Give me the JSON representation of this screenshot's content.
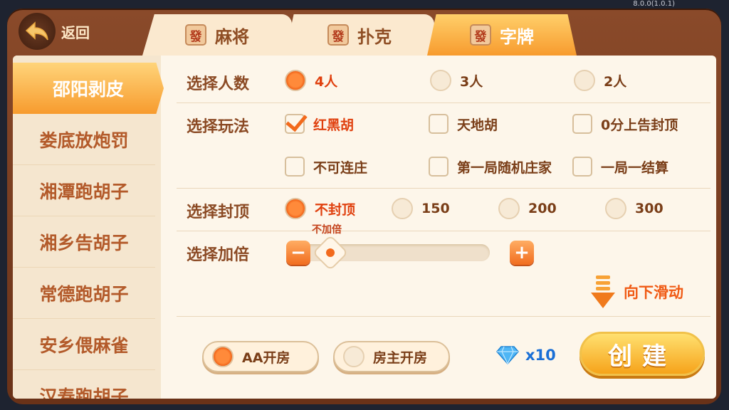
{
  "version": "8.0.0(1.0.1)",
  "header": {
    "back_label": "返回",
    "tabs": [
      {
        "tile": "發",
        "label": "麻将"
      },
      {
        "tile": "發",
        "label": "扑克"
      },
      {
        "tile": "發",
        "label": "字牌",
        "active": true
      }
    ]
  },
  "sidebar": {
    "items": [
      {
        "label": "邵阳剥皮",
        "active": true
      },
      {
        "label": "娄底放炮罚"
      },
      {
        "label": "湘潭跑胡子"
      },
      {
        "label": "湘乡告胡子"
      },
      {
        "label": "常德跑胡子"
      },
      {
        "label": "安乡偎麻雀"
      },
      {
        "label": "汉寿跑胡子"
      }
    ]
  },
  "form": {
    "players": {
      "label": "选择人数",
      "options": [
        {
          "label": "4人",
          "selected": true
        },
        {
          "label": "3人",
          "selected": false
        },
        {
          "label": "2人",
          "selected": false
        }
      ]
    },
    "gameplay": {
      "label": "选择玩法",
      "options": [
        {
          "label": "红黑胡",
          "checked": true
        },
        {
          "label": "天地胡",
          "checked": false
        },
        {
          "label": "0分上告封顶",
          "checked": false
        },
        {
          "label": "不可连庄",
          "checked": false
        },
        {
          "label": "第一局随机庄家",
          "checked": false
        },
        {
          "label": "一局一结算",
          "checked": false
        }
      ]
    },
    "cap": {
      "label": "选择封顶",
      "options": [
        {
          "label": "不封顶",
          "selected": true
        },
        {
          "label": "150",
          "selected": false
        },
        {
          "label": "200",
          "selected": false
        },
        {
          "label": "300",
          "selected": false
        }
      ]
    },
    "multiplier": {
      "label": "选择加倍",
      "value_label": "不加倍",
      "minus": "−",
      "plus": "+",
      "level": 0
    },
    "scroll_hint": "向下滑动"
  },
  "footer": {
    "pay_options": [
      {
        "label": "AA开房",
        "selected": true
      },
      {
        "label": "房主开房",
        "selected": false
      }
    ],
    "cost": "x10",
    "create_label": "创建"
  },
  "colors": {
    "accent": "#f26a1c",
    "panel": "#fdf6ea",
    "frame": "#7a3a1c"
  }
}
